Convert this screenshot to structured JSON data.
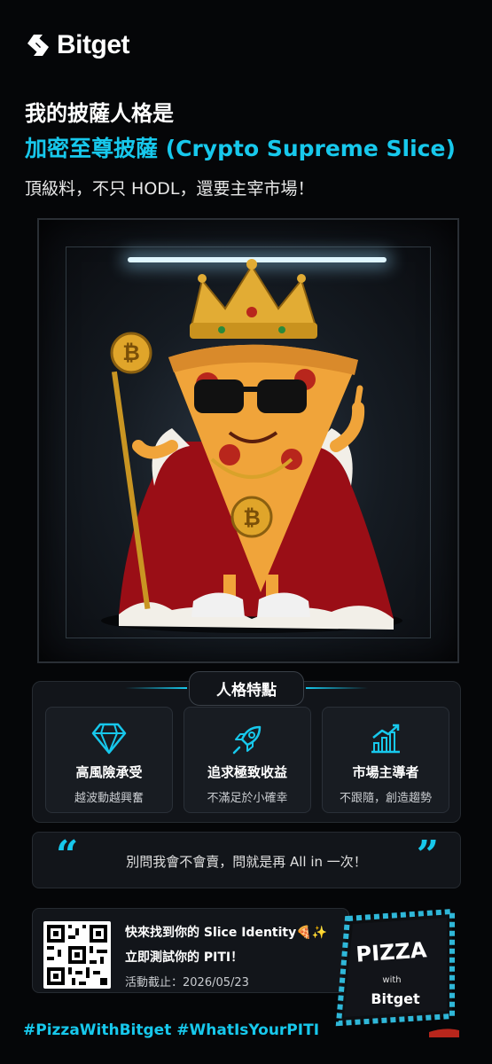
{
  "brand": {
    "name": "Bitget",
    "logo_icon": "bitget-arrows-icon"
  },
  "header": {
    "line1": "我的披薩人格是",
    "line2": "加密至尊披薩 (Crypto Supreme Slice)",
    "line3": "頂級料，不只 HODL，還要主宰市場！"
  },
  "colors": {
    "accent": "#17c8ec",
    "background": "#050608",
    "card": "#12151a"
  },
  "traits": {
    "title": "人格特點",
    "items": [
      {
        "icon": "diamond-icon",
        "title": "高風險承受",
        "desc": "越波動越興奮"
      },
      {
        "icon": "rocket-icon",
        "title": "追求極致收益",
        "desc": "不滿足於小確幸"
      },
      {
        "icon": "rising-chart-icon",
        "title": "市場主導者",
        "desc": "不跟隨，創造趨勢"
      }
    ]
  },
  "quote": {
    "open_mark": "“",
    "close_mark": "”",
    "text": "別問我會不會賣，問就是再 All in 一次！"
  },
  "cta": {
    "line1": "快來找到你的 Slice Identity🍕✨",
    "line2": "立即測試你的 PITI！",
    "line3": "活動截止：2026/05/23"
  },
  "pizza_box": {
    "title": "PIZZA",
    "with": "with",
    "brand": "Bitget"
  },
  "hashtags": "#PizzaWithBitget #WhatIsYourPITI"
}
